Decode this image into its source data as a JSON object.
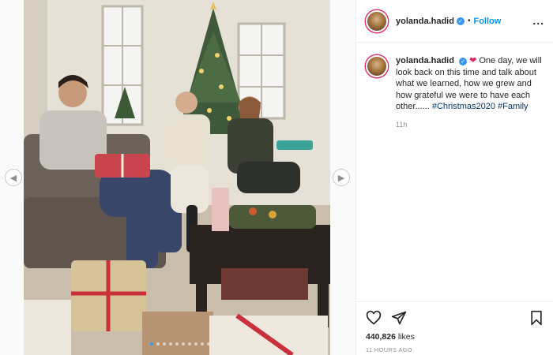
{
  "post": {
    "photo_alt": "",
    "carousel_total": 10,
    "carousel_active": 1
  },
  "header": {
    "username": "yolanda.hadid",
    "verified_icon": "verified-badge-icon",
    "separator": "•",
    "follow_label": "Follow",
    "more_label": "..."
  },
  "caption": {
    "username": "yolanda.hadid",
    "heart": "❤",
    "text": " One day, we will look back on this time and talk about what we learned, how we grew and how grateful we were to have each other...... ",
    "hashtag_1": "#Christmas2020",
    "hashtag_2": "#Family",
    "age": "11h"
  },
  "actions": {
    "likes_count": "440,826",
    "likes_label": " likes",
    "timestamp": "11 HOURS AGO",
    "icons": [
      "heart-icon",
      "share-icon",
      "bookmark-icon"
    ]
  },
  "colors": {
    "accent": "#0095f6",
    "verified": "#3897f0",
    "hashtag": "#00376b",
    "muted": "#8e8e8e"
  }
}
